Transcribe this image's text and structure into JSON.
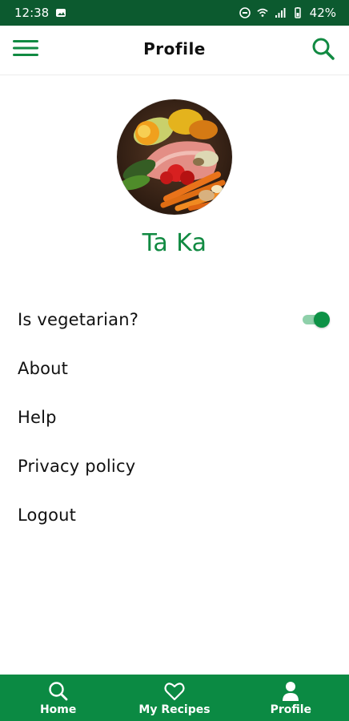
{
  "status_bar": {
    "time": "12:38",
    "battery": "42%"
  },
  "app_bar": {
    "title": "Profile"
  },
  "profile": {
    "name": "Ta Ka"
  },
  "menu": {
    "items": [
      {
        "label": "Is vegetarian?"
      },
      {
        "label": "About"
      },
      {
        "label": "Help"
      },
      {
        "label": "Privacy policy"
      },
      {
        "label": "Logout"
      }
    ],
    "vegetarian_enabled": true
  },
  "bottom_nav": {
    "items": [
      {
        "label": "Home",
        "icon": "search-icon"
      },
      {
        "label": "My Recipes",
        "icon": "heart-icon"
      },
      {
        "label": "Profile",
        "icon": "user-icon"
      }
    ]
  },
  "colors": {
    "status_bar": "#0c5a2f",
    "accent": "#118a42",
    "bottom_nav": "#0b8a43",
    "toggle_track": "#8fd0aa",
    "toggle_thumb": "#0d9246"
  }
}
